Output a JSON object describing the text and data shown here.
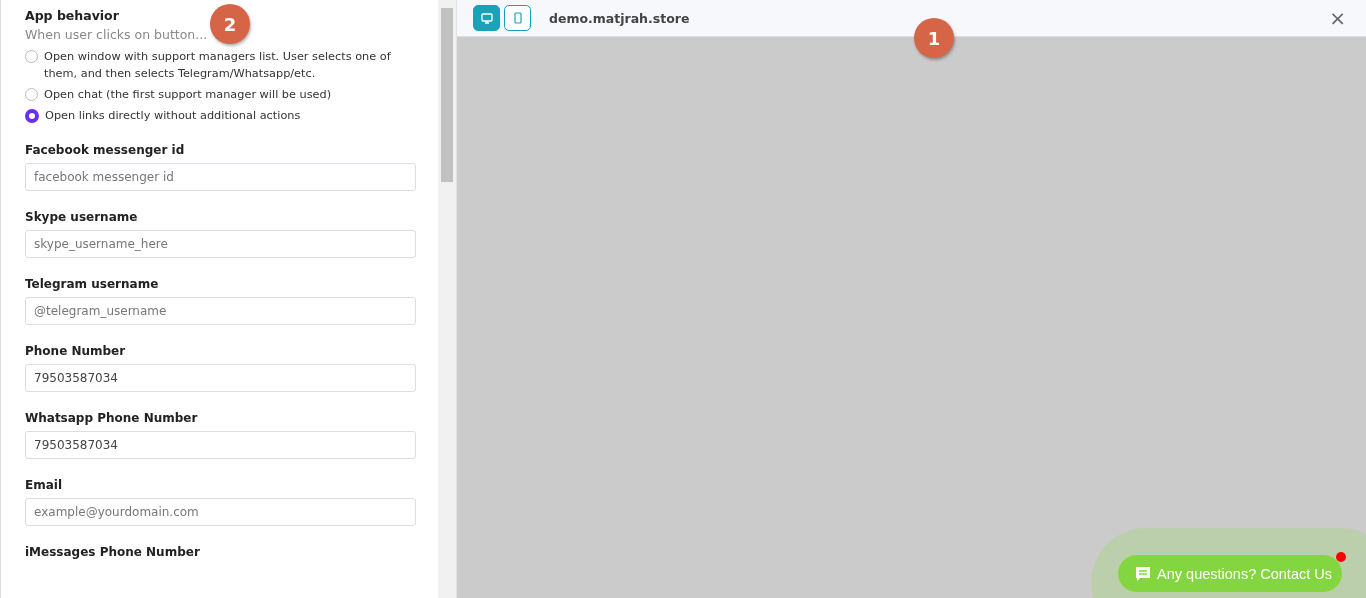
{
  "settings": {
    "section_title": "App behavior",
    "section_hint": "When user clicks on button...",
    "behavior_options": [
      {
        "label": "Open window with support managers list. User selects one of them, and then selects Telegram/Whatsapp/etc.",
        "selected": false
      },
      {
        "label": "Open chat (the first support manager will be used)",
        "selected": false
      },
      {
        "label": "Open links directly without additional actions",
        "selected": true
      }
    ],
    "fields": [
      {
        "label": "Facebook messenger id",
        "placeholder": "facebook messenger id"
      },
      {
        "label": "Skype username",
        "placeholder": "skype_username_here"
      },
      {
        "label": "Telegram username",
        "placeholder": "@telegram_username"
      },
      {
        "label": "Phone Number",
        "value": "79503587034"
      },
      {
        "label": "Whatsapp Phone Number",
        "value": "79503587034"
      },
      {
        "label": "Email",
        "placeholder": "example@yourdomain.com"
      },
      {
        "label": "iMessages Phone Number"
      }
    ]
  },
  "preview": {
    "devices": [
      {
        "kind": "desktop",
        "selected": true
      },
      {
        "kind": "mobile",
        "selected": false
      }
    ],
    "site": "demo.matjrah.store",
    "close": "×",
    "contact_button": {
      "label": "Any questions? Contact Us",
      "notification": true
    }
  },
  "markers": [
    {
      "label": "2"
    },
    {
      "label": "1"
    }
  ]
}
